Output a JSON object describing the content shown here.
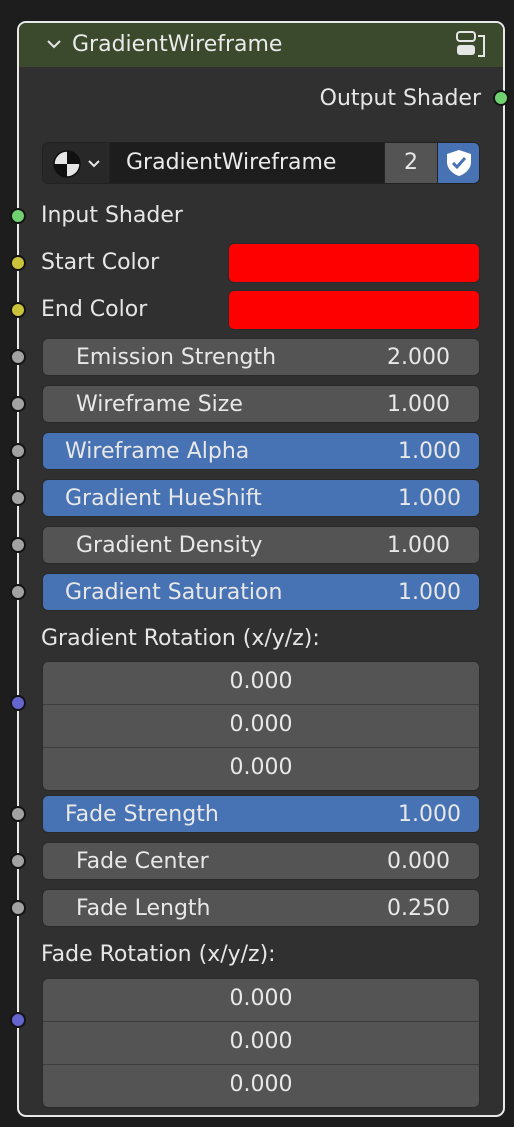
{
  "node": {
    "title": "GradientWireframe",
    "output_label": "Output Shader",
    "datablock": {
      "name": "GradientWireframe",
      "users": "2"
    },
    "inputs": {
      "input_shader": "Input Shader",
      "start_color": "Start Color",
      "end_color": "End Color"
    },
    "fields": [
      {
        "name": "Emission Strength",
        "value": "2.000"
      },
      {
        "name": "Wireframe Size",
        "value": "1.000"
      },
      {
        "name": "Wireframe Alpha",
        "value": "1.000"
      },
      {
        "name": "Gradient HueShift",
        "value": "1.000"
      },
      {
        "name": "Gradient Density",
        "value": "1.000"
      },
      {
        "name": "Gradient Saturation",
        "value": "1.000"
      }
    ],
    "gradient_rotation": {
      "label": "Gradient Rotation (x/y/z):",
      "x": "0.000",
      "y": "0.000",
      "z": "0.000"
    },
    "fade_fields": [
      {
        "name": "Fade Strength",
        "value": "1.000"
      },
      {
        "name": "Fade Center",
        "value": "0.000"
      },
      {
        "name": "Fade Length",
        "value": "0.250"
      }
    ],
    "fade_rotation": {
      "label": "Fade Rotation (x/y/z):",
      "x": "0.000",
      "y": "0.000",
      "z": "0.000"
    }
  },
  "colors": {
    "header": "#3b4a2c",
    "node_bg": "#303030",
    "accent": "#4772b3",
    "start_color": "#ff0000",
    "end_color": "#ff0000",
    "socket_shader": "#6fd16f",
    "socket_color": "#c9c23a",
    "socket_float": "#a2a2a2",
    "socket_vector": "#6565cf"
  },
  "icons": {
    "collapse": "chevron-down-icon",
    "node_group": "node-group-icon",
    "material": "material-sphere-icon",
    "fake_user": "shield-check-icon"
  }
}
